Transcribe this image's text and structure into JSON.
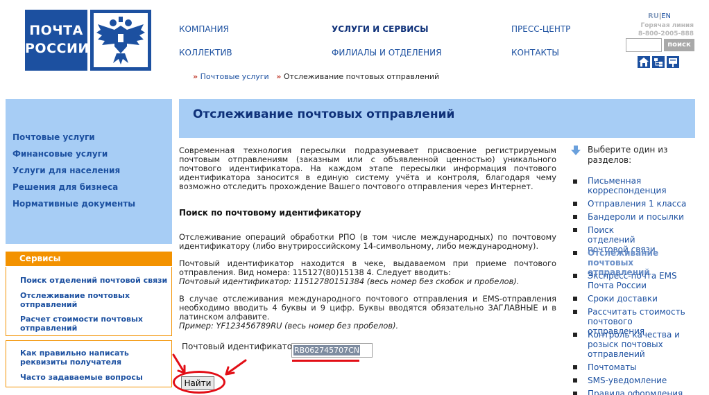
{
  "logo": {
    "line1": "ПОЧТА",
    "line2": "РОССИИ"
  },
  "header": {
    "nav": [
      {
        "label": "КОМПАНИЯ",
        "bold": false
      },
      {
        "label": "УСЛУГИ И СЕРВИСЫ",
        "bold": true
      },
      {
        "label": "ПРЕСС-ЦЕНТР",
        "bold": false
      },
      {
        "label": "КОЛЛЕКТИВ",
        "bold": false
      },
      {
        "label": "ФИЛИАЛЫ И ОТДЕЛЕНИЯ",
        "bold": false
      },
      {
        "label": "КОНТАКТЫ",
        "bold": false
      }
    ],
    "lang_ru": "RU",
    "lang_sep": "|",
    "lang_en": "EN",
    "hotline_label": "Горячая линия",
    "hotline_number": "8-800-2005-888",
    "search_button": "поиск",
    "icons": [
      "home-icon",
      "sitemap-icon",
      "mail-icon"
    ]
  },
  "breadcrumb": {
    "arrow": "»",
    "link": "Почтовые услуги",
    "current": "Отслеживание почтовых отправлений"
  },
  "sidebar": {
    "items": [
      "Почтовые услуги",
      "Финансовые услуги",
      "Услуги для населения",
      "Решения для бизнеса",
      "Нормативные документы"
    ],
    "services_title": "Сервисы",
    "services": [
      "Поиск отделений почтовой связи",
      "Отслеживание почтовых отправлений",
      "Расчет стоимости почтовых отправлений"
    ],
    "help": [
      "Как правильно написать реквизиты получателя",
      "Часто задаваемые вопросы"
    ]
  },
  "main": {
    "title": "Отслеживание почтовых отправлений",
    "intro": "Современная технология пересылки подразумевает присвоение регистрируемым почтовым отправлениям (заказным или с объявленной ценностью) уникального почтового идентификатора. На каждом этапе пересылки информация почтового идентификатора заносится в единую систему учёта и контроля, благодаря чему возможно отследить прохождение Вашего почтового отправления через Интернет.",
    "subhead": "Поиск по почтовому идентификатору",
    "p1": "Отслеживание операций обработки РПО (в том числе международных) по почтовому идентификатору (либо внутрироссийскому 14-символьному, либо международному).",
    "p2": "Почтовый идентификатор находится в чеке, выдаваемом при приеме почтового отправления. Вид номера: 115127(80)15138 4. Следует вводить:",
    "p2_example": "Почтовый идентификатор: 11512780151384 (весь номер без скобок и пробелов).",
    "p3": "В случае отслеживания международного почтового отправления и EMS-отправления необходимо вводить 4 буквы и 9 цифр. Буквы вводятся обязательно ЗАГЛАВНЫЕ и в латинском алфавите.",
    "p3_example": "Пример: YF123456789RU (весь номер без пробелов).",
    "field_label": "Почтовый идентификатор:",
    "field_value": "RB062745707CN",
    "submit_label": "Найти"
  },
  "right": {
    "heading": "Выберите один из разделов:",
    "items": [
      {
        "label": "Письменная корреспонденция",
        "active": false
      },
      {
        "label": "Отправления 1 класса",
        "active": false
      },
      {
        "label": "Бандероли и посылки",
        "active": false
      },
      {
        "label": "Поиск отделений почтовой связи",
        "active": false
      },
      {
        "label": "Отслеживание почтовых отправлений",
        "active": true
      },
      {
        "label": "Экспресс-почта EMS Почта России",
        "active": false
      },
      {
        "label": "Сроки доставки",
        "active": false
      },
      {
        "label": "Рассчитать стоимость почтового отправления",
        "active": false
      },
      {
        "label": "Контроль качества и розыск почтовых отправлений",
        "active": false
      },
      {
        "label": "Почтоматы",
        "active": false
      },
      {
        "label": "SMS-уведомление",
        "active": false
      },
      {
        "label": "Правила оформления",
        "active": false
      }
    ]
  },
  "colors": {
    "brand_blue": "#1c50a0",
    "panel_blue": "#a7cdf5",
    "accent_orange": "#f39200",
    "annotation_red": "#e20e16"
  }
}
